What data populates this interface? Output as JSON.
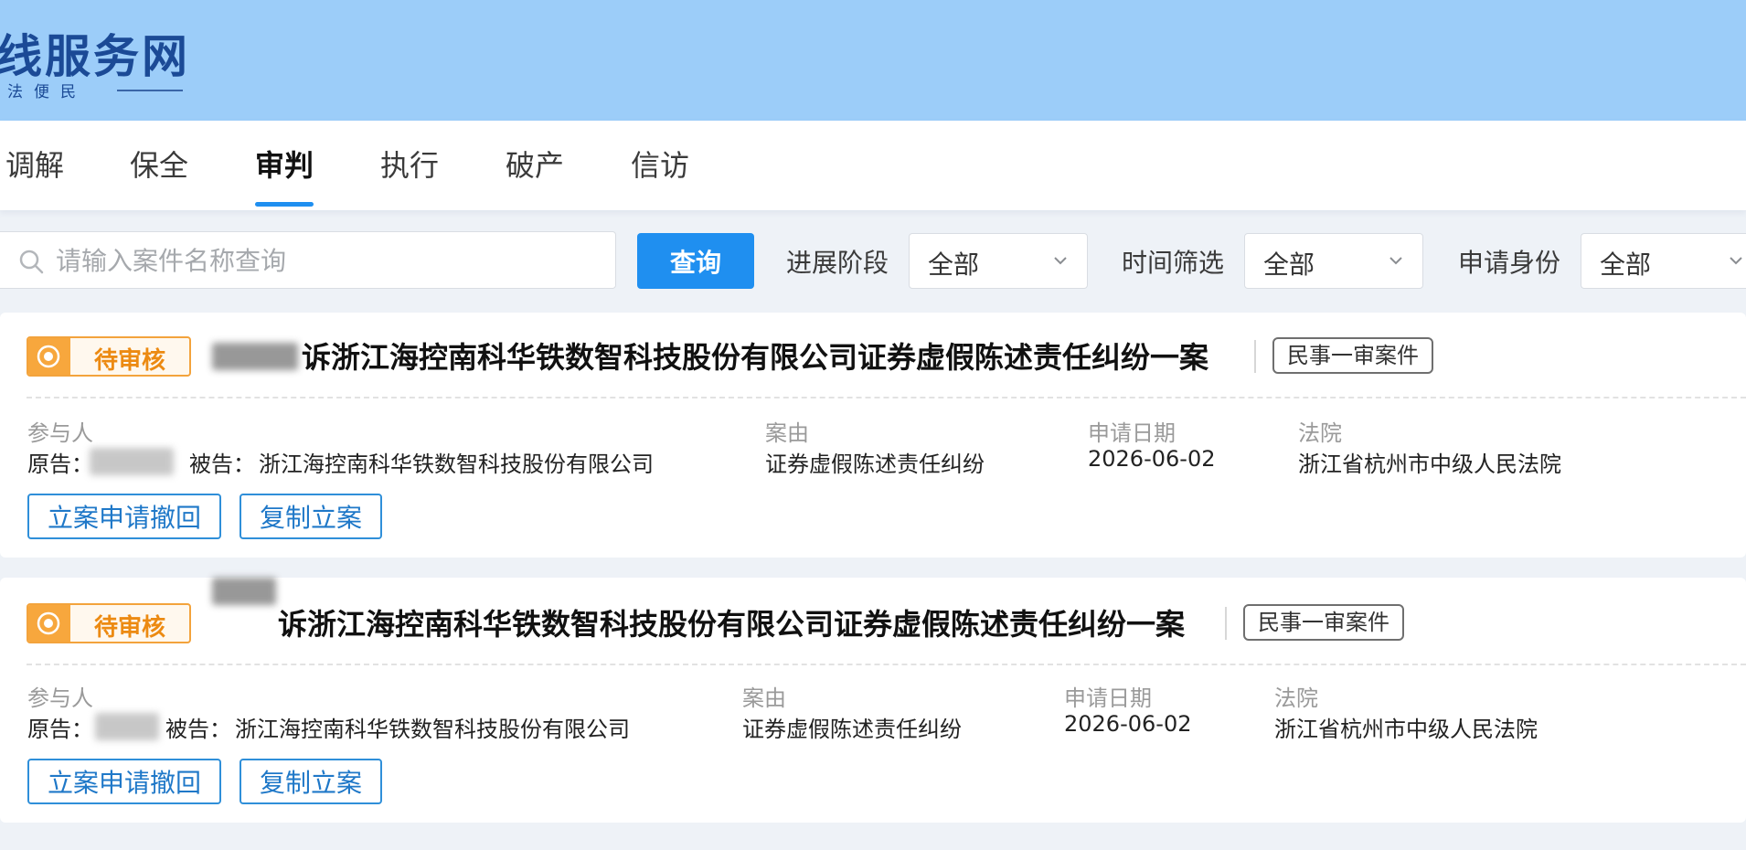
{
  "header": {
    "site_title": "线服务网",
    "slogan": "法便民"
  },
  "nav": {
    "tabs": [
      {
        "label": "调解",
        "active": false
      },
      {
        "label": "保全",
        "active": false
      },
      {
        "label": "审判",
        "active": true
      },
      {
        "label": "执行",
        "active": false
      },
      {
        "label": "破产",
        "active": false
      },
      {
        "label": "信访",
        "active": false
      }
    ]
  },
  "filters": {
    "search_placeholder": "请输入案件名称查询",
    "search_value": "",
    "query_button": "查询",
    "stage_label": "进展阶段",
    "stage_value": "全部",
    "time_label": "时间筛选",
    "time_value": "全部",
    "identity_label": "申请身份",
    "identity_value": "全部"
  },
  "labels": {
    "participants": "参与人",
    "cause": "案由",
    "apply_date": "申请日期",
    "court": "法院",
    "plaintiff_prefix": "原告：",
    "defendant_prefix": "被告：",
    "withdraw_button": "立案申请撤回",
    "copy_button": "复制立案"
  },
  "cases": [
    {
      "status": "待审核",
      "title": "诉浙江海控南科华铁数智科技股份有限公司证券虚假陈述责任纠纷一案",
      "case_type": "民事一审案件",
      "defendant": "浙江海控南科华铁数智科技股份有限公司",
      "cause": "证券虚假陈述责任纠纷",
      "apply_date": "2026-06-02",
      "court": "浙江省杭州市中级人民法院"
    },
    {
      "status": "待审核",
      "title": "诉浙江海控南科华铁数智科技股份有限公司证券虚假陈述责任纠纷一案",
      "case_type": "民事一审案件",
      "defendant": "浙江海控南科华铁数智科技股份有限公司",
      "cause": "证券虚假陈述责任纠纷",
      "apply_date": "2026-06-02",
      "court": "浙江省杭州市中级人民法院"
    }
  ],
  "colors": {
    "header_bg": "#9ccdf9",
    "brand_blue": "#1b4a96",
    "accent": "#1f8ff0",
    "pending_orange": "#f3a33c"
  }
}
